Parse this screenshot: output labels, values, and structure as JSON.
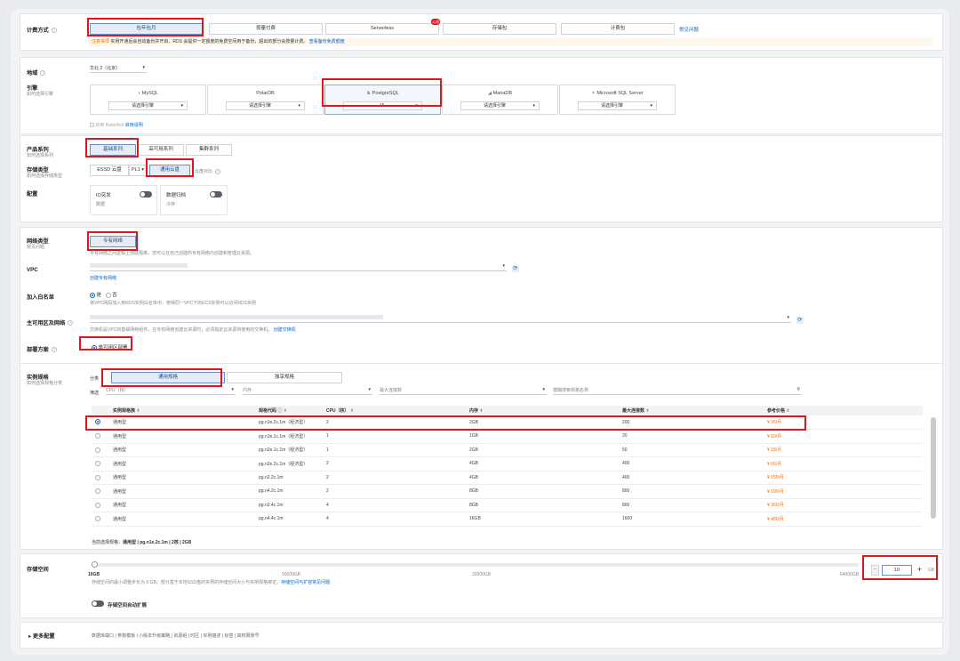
{
  "billing": {
    "label": "计费方式",
    "options": [
      "包年包月",
      "按量付费",
      "Serverless",
      "存储包",
      "计费包"
    ],
    "serverless_badge": "公测",
    "faq": "常见问题",
    "notice_prefix": "注意事项",
    "notice_text": "实例开通后会自动备份并开启，RDS 会提供一定额度的免费空间用于备份，超出的部分会按量计费。",
    "notice_link": "查看备份免费额度"
  },
  "region": {
    "label": "地域",
    "value": "华北 2（北京）"
  },
  "engine": {
    "label": "引擎",
    "sub": "如何选择引擎",
    "engines": [
      {
        "name": "MySQL",
        "icon": "dolphin-icon",
        "version": "请选择引擎"
      },
      {
        "name": "PolarDB",
        "icon": "polardb-icon",
        "version": "请选择引擎"
      },
      {
        "name": "PostgreSQL",
        "icon": "elephant-icon",
        "version": "16"
      },
      {
        "name": "MariaDB",
        "icon": "seal-icon",
        "version": "请选择引擎"
      },
      {
        "name": "Microsoft SQL Server",
        "icon": "sqlserver-icon",
        "version": "请选择引擎"
      }
    ],
    "babelfish": "启用 Babelfish",
    "babelfish_link": "启用说明"
  },
  "series": {
    "label": "产品系列",
    "sub": "如何选择系列",
    "options": [
      "基础系列",
      "高可用系列",
      "集群系列"
    ]
  },
  "storage_type": {
    "label": "存储类型",
    "sub": "如何选择存储类型",
    "essd": "ESSD 云盘",
    "pl": "PL1",
    "general": "通用云盘",
    "compare": "云盘对比"
  },
  "config": {
    "label": "配置",
    "io_title": "IO突发",
    "io_desc": "数据",
    "archive_title": "数据归档",
    "archive_desc": "冷存"
  },
  "network": {
    "label": "网络类型",
    "sub": "常见问题",
    "option": "专有网络",
    "hint": "专有网络之间逻辑上彻底隔离，您可以在自己创建的专有网络内创建和管理云资源。",
    "vpc_label": "VPC",
    "vpc_link": "创建专有网络",
    "whitelist_label": "加入白名单",
    "whitelist_yes": "是",
    "whitelist_no": "否",
    "whitelist_hint": "将VPC网段加入到RDS实例白名单中，使得同一VPC下的ECS实例可以访问RDS实例",
    "zone_label": "主可用区及网络",
    "zone_hint": "交换机是VPC的基础网络组件，在专有网络创建云资源时，必须指定云资源将使用的交换机。",
    "zone_link": "创建交换机",
    "deploy_label": "部署方案",
    "deploy_option": "单可用区部署"
  },
  "spec": {
    "label": "实例规格",
    "sub": "如何选择规格分类",
    "category_label": "分类",
    "categories": [
      "通用规格",
      "独享规格"
    ],
    "filter_label": "筛选",
    "filter_cpu": "CPU（核）",
    "filter_mem": "内存",
    "filter_conn": "最大连接数",
    "filter_search": "模糊搜索规格名称",
    "columns": [
      "实例规格族",
      "规格代码",
      "CPU（核）",
      "内存",
      "最大连接数",
      "参考价格"
    ],
    "rows": [
      {
        "family": "通用型",
        "code": "pg.n1e.2c.1m（经济型）",
        "cpu": "2",
        "mem": "2GB",
        "conn": "200",
        "price": "¥ 36/月",
        "selected": true
      },
      {
        "family": "通用型",
        "code": "pg.n1e.1c.1m（经济型）",
        "cpu": "1",
        "mem": "1GB",
        "conn": "20",
        "price": "¥ 10/月",
        "selected": false
      },
      {
        "family": "通用型",
        "code": "pg.n2e.1c.1m（经济型）",
        "cpu": "1",
        "mem": "2GB",
        "conn": "50",
        "price": "¥ 18/月",
        "selected": false
      },
      {
        "family": "通用型",
        "code": "pg.n2e.2c.1m（经济型）",
        "cpu": "2",
        "mem": "4GB",
        "conn": "400",
        "price": "¥ 66/月",
        "selected": false
      },
      {
        "family": "通用型",
        "code": "pg.n2.2c.1m",
        "cpu": "2",
        "mem": "4GB",
        "conn": "400",
        "price": "¥ 150/月",
        "selected": false
      },
      {
        "family": "通用型",
        "code": "pg.n4.2c.1m",
        "cpu": "2",
        "mem": "8GB",
        "conn": "800",
        "price": "¥ 190/月",
        "selected": false
      },
      {
        "family": "通用型",
        "code": "pg.n2.4c.1m",
        "cpu": "4",
        "mem": "8GB",
        "conn": "800",
        "price": "¥ 360/月",
        "selected": false
      },
      {
        "family": "通用型",
        "code": "pg.n4.4c.1m",
        "cpu": "4",
        "mem": "16GB",
        "conn": "1600",
        "price": "¥ 480/月",
        "selected": false
      }
    ],
    "current_prefix": "当前选择规格：",
    "current_value": "通用型 | pg.n1e.2c.1m | 2核 | 2GB"
  },
  "storage": {
    "label": "存储空间",
    "ticks": [
      "10GB",
      "16000GB",
      "32000GB",
      "64000GB"
    ],
    "hint": "存储空间的最小调整步长为 5 GB。部分基于本地SSD盘的实例的存储空间大小与实例规格绑定。",
    "hint_link": "存储空间与扩容常见问题",
    "value": "10",
    "unit": "GB",
    "minus": "−",
    "plus": "+",
    "autoscale": "存储空间自动扩展",
    "value_fraction": 0
  },
  "more": {
    "label": "更多配置",
    "items": "数据库端口 | 参数模板 | 小版本升级策略 | 资源组 | 时区 | 实例描述 | 标签 | 高权限账号"
  },
  "colors": {
    "accent": "#0064c8",
    "highlight": "#e1161c",
    "price": "#ff6a00"
  }
}
